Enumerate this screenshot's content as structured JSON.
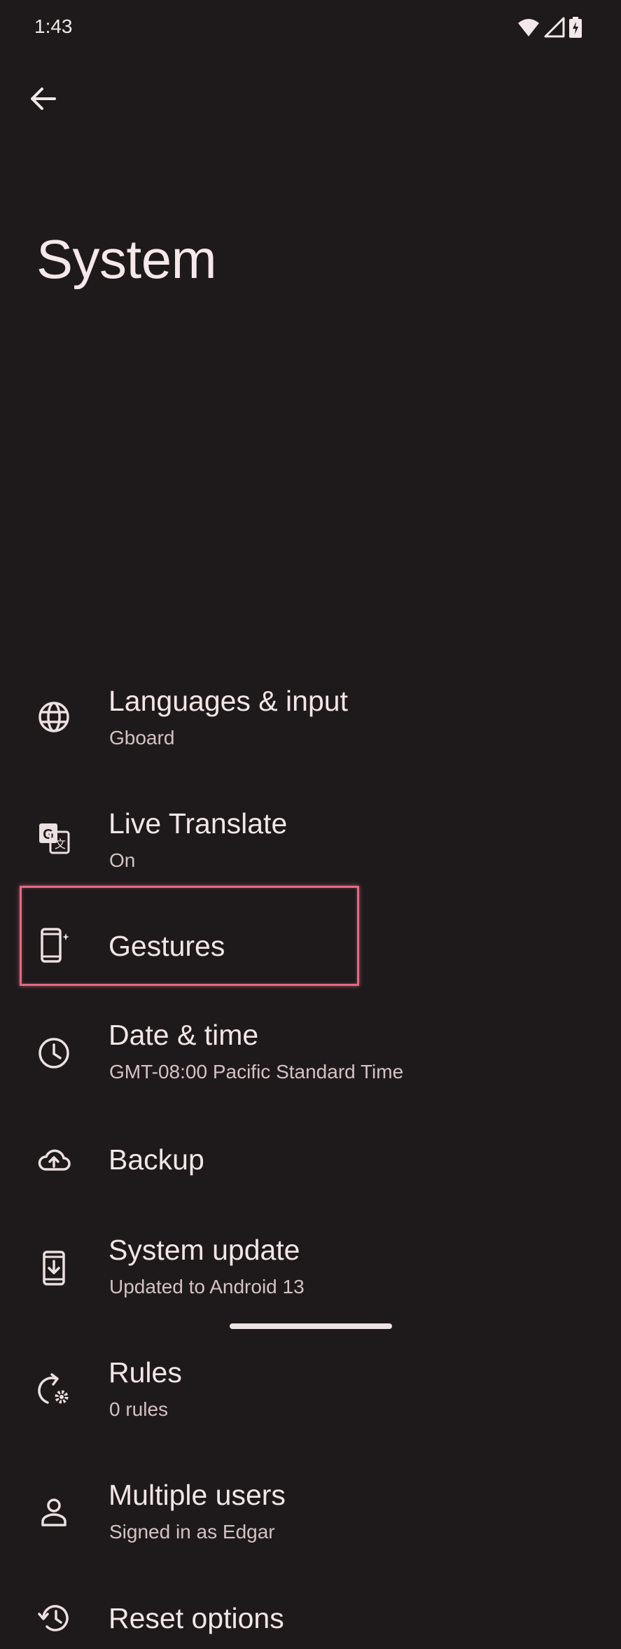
{
  "status_bar": {
    "time": "1:43",
    "icons": [
      "wifi-icon",
      "cellular-signal-icon",
      "battery-charging-icon"
    ]
  },
  "header": {
    "back_icon": "arrow-back-icon",
    "title": "System"
  },
  "settings": [
    {
      "id": "languages",
      "icon": "globe-icon",
      "title": "Languages & input",
      "subtitle": "Gboard"
    },
    {
      "id": "live-translate",
      "icon": "translate-icon",
      "title": "Live Translate",
      "subtitle": "On"
    },
    {
      "id": "gestures",
      "icon": "gesture-phone-icon",
      "title": "Gestures",
      "subtitle": ""
    },
    {
      "id": "date-time",
      "icon": "clock-icon",
      "title": "Date & time",
      "subtitle": "GMT-08:00 Pacific Standard Time"
    },
    {
      "id": "backup",
      "icon": "cloud-upload-icon",
      "title": "Backup",
      "subtitle": ""
    },
    {
      "id": "system-update",
      "icon": "system-update-icon",
      "title": "System update",
      "subtitle": "Updated to Android 13",
      "highlighted": true
    },
    {
      "id": "rules",
      "icon": "rules-icon",
      "title": "Rules",
      "subtitle": "0 rules"
    },
    {
      "id": "multiple-users",
      "icon": "person-icon",
      "title": "Multiple users",
      "subtitle": "Signed in as Edgar"
    },
    {
      "id": "reset-options",
      "icon": "history-icon",
      "title": "Reset options",
      "subtitle": ""
    }
  ],
  "colors": {
    "background": "#1e1a1b",
    "text_primary": "#f2e6e6",
    "text_secondary": "#d4c2c3",
    "highlight": "#e06a85"
  }
}
